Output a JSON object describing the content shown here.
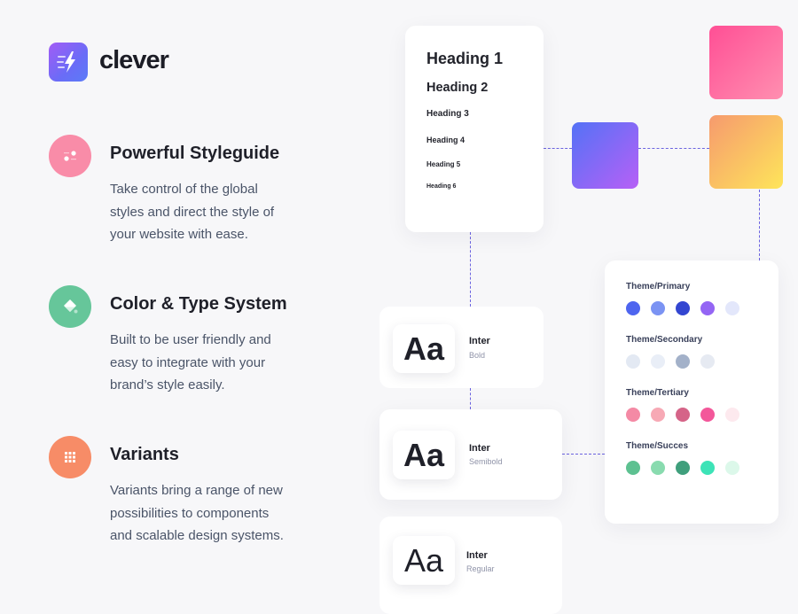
{
  "brand": {
    "name": "clever",
    "icon": "bolt-icon",
    "color_from": "#a25cf5",
    "color_to": "#5b7bf7"
  },
  "features": [
    {
      "icon": "nodes-icon",
      "icon_color": "#f98ca8",
      "title": "Powerful Styleguide",
      "lines": [
        "Take control of the global",
        "styles and direct the style of",
        "your website with ease."
      ]
    },
    {
      "icon": "paint-bucket-icon",
      "icon_color": "#66c69a",
      "title": "Color & Type System",
      "lines": [
        "Built to be user friendly and",
        "easy to integrate with your",
        "brand’s style easily."
      ]
    },
    {
      "icon": "grid-icon",
      "icon_color": "#f78c67",
      "title": "Variants",
      "lines": [
        "Variants bring a range of new",
        "possibilities to components",
        "and scalable design systems."
      ]
    }
  ],
  "headings": [
    "Heading 1",
    "Heading 2",
    "Heading 3",
    "Heading 4",
    "Heading 5",
    "Heading 6"
  ],
  "swatches": {
    "pink": [
      "#ff4f95",
      "#ff8fb0"
    ],
    "purple": [
      "#5472f6",
      "#b760f6"
    ],
    "orange": [
      "#f69a6e",
      "#fee55a"
    ]
  },
  "type_samples": [
    {
      "sample": "Aa",
      "family": "Inter",
      "weight": "Bold"
    },
    {
      "sample": "Aa",
      "family": "Inter",
      "weight": "Semibold"
    },
    {
      "sample": "Aa",
      "family": "Inter",
      "weight": "Regular"
    }
  ],
  "palettes": [
    {
      "label": "Theme/Primary",
      "colors": [
        "#4e65ef",
        "#7b93f3",
        "#3346d1",
        "#9465f4",
        "#e3e7fb"
      ]
    },
    {
      "label": "Theme/Secondary",
      "colors": [
        "#e3e9f3",
        "#e9eef7",
        "#a3b1c9",
        "#e6eaf2"
      ]
    },
    {
      "label": "Theme/Tertiary",
      "colors": [
        "#f48aa5",
        "#f7a9b5",
        "#d56488",
        "#f3579a",
        "#fde9ee"
      ]
    },
    {
      "label": "Theme/Succes",
      "colors": [
        "#5dc191",
        "#89dbaf",
        "#3f9f7c",
        "#3de3b7",
        "#dcf8ea"
      ]
    }
  ]
}
